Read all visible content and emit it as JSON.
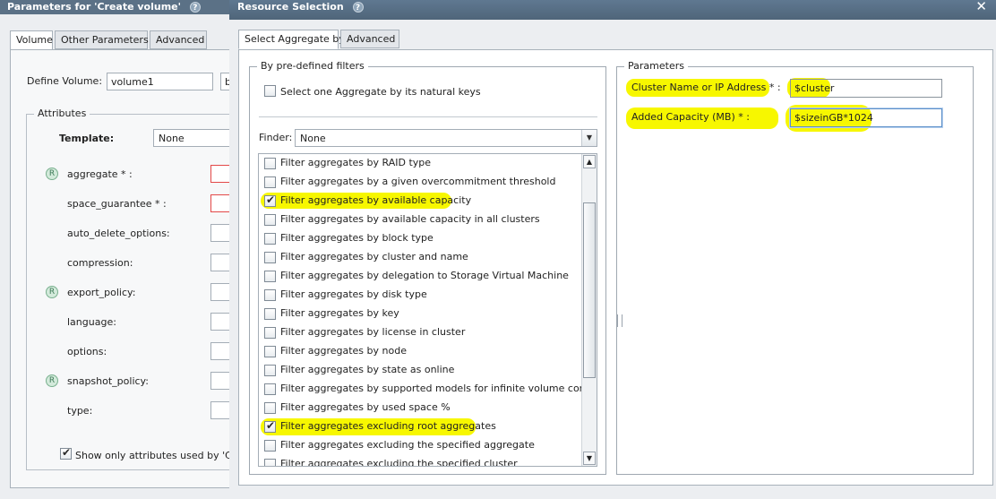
{
  "background_dialog": {
    "title": "Parameters for 'Create volume'",
    "tabs": [
      "Volume",
      "Other Parameters",
      "Advanced"
    ],
    "define_volume_label": "Define Volume:",
    "define_volume_value": "volume1",
    "define_volume_button": "b",
    "attributes_legend": "Attributes",
    "template_label": "Template:",
    "template_value": "None",
    "attributes": [
      {
        "label": "aggregate * :",
        "badge": "R"
      },
      {
        "label": "space_guarantee * :",
        "badge": ""
      },
      {
        "label": "auto_delete_options:",
        "badge": ""
      },
      {
        "label": "compression:",
        "badge": ""
      },
      {
        "label": "export_policy:",
        "badge": "R"
      },
      {
        "label": "language:",
        "badge": ""
      },
      {
        "label": "options:",
        "badge": ""
      },
      {
        "label": "snapshot_policy:",
        "badge": "R"
      },
      {
        "label": "type:",
        "badge": ""
      }
    ],
    "show_only_label": "Show only attributes used by 'Creat"
  },
  "dialog": {
    "title": "Resource Selection",
    "help_glyph": "?",
    "close_glyph": "✕",
    "tabs": [
      "Select Aggregate by",
      "Advanced"
    ],
    "predefined": {
      "legend": "By pre-defined filters",
      "natural_keys_label": "Select one Aggregate by its natural keys",
      "finder_label": "Finder:",
      "finder_value": "None",
      "filters": [
        {
          "label": "Filter aggregates by RAID type",
          "checked": false
        },
        {
          "label": "Filter aggregates by a given overcommitment threshold",
          "checked": false
        },
        {
          "label": "Filter aggregates by available capacity",
          "checked": true
        },
        {
          "label": "Filter aggregates by available capacity in all clusters",
          "checked": false
        },
        {
          "label": "Filter aggregates by block type",
          "checked": false
        },
        {
          "label": "Filter aggregates by cluster and name",
          "checked": false
        },
        {
          "label": "Filter aggregates by delegation to Storage Virtual Machine",
          "checked": false
        },
        {
          "label": "Filter aggregates by disk type",
          "checked": false
        },
        {
          "label": "Filter aggregates by key",
          "checked": false
        },
        {
          "label": "Filter aggregates by license in cluster",
          "checked": false
        },
        {
          "label": "Filter aggregates by node",
          "checked": false
        },
        {
          "label": "Filter aggregates by state as online",
          "checked": false
        },
        {
          "label": "Filter aggregates by supported models for infinite volume constituents",
          "checked": false
        },
        {
          "label": "Filter aggregates by used space %",
          "checked": false
        },
        {
          "label": "Filter aggregates excluding root aggregates",
          "checked": true
        },
        {
          "label": "Filter aggregates excluding the specified aggregate",
          "checked": false
        },
        {
          "label": "Filter aggregates excluding the specified cluster",
          "checked": false
        }
      ]
    },
    "parameters": {
      "legend": "Parameters",
      "fields": [
        {
          "label": "Cluster Name or IP Address * :",
          "value": "$cluster"
        },
        {
          "label": "Added Capacity (MB) * :",
          "value": "$sizeinGB*1024"
        }
      ]
    }
  },
  "colors": {
    "highlight": "#f7f700",
    "title_bar": "#5f7891",
    "required_border": "#e34848",
    "badge_green": "#3c7a56"
  }
}
